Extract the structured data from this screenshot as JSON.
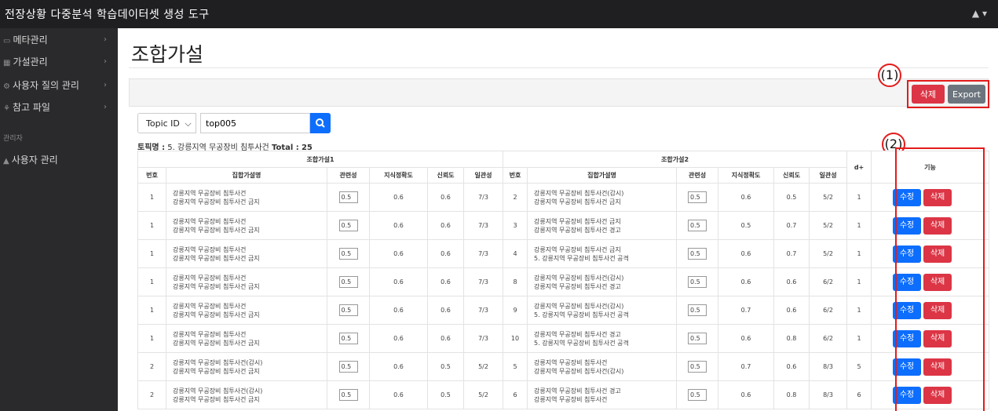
{
  "app": {
    "title": "전장상황 다중분석 학습데이터셋 생성 도구",
    "user_menu": "▲ ▾"
  },
  "sidebar": {
    "items": [
      {
        "icon": "▭",
        "label": "메타관리",
        "chevron": "›"
      },
      {
        "icon": "▦",
        "label": "가설관리",
        "chevron": "›"
      },
      {
        "icon": "⚙",
        "label": "사용자 질의 관리",
        "chevron": "›"
      },
      {
        "icon": "⚘",
        "label": "참고 파일",
        "chevron": "›"
      }
    ],
    "section_heading": "관리자",
    "admin_item": {
      "icon": "▲",
      "label": "사용자 관리"
    }
  },
  "page": {
    "title": "조합가설"
  },
  "toolbar": {
    "delete_label": "삭제",
    "export_label": "Export"
  },
  "annotations": {
    "one": "(1)",
    "two": "(2)"
  },
  "search": {
    "select_value": "Topic ID",
    "select_caret": "⌵",
    "input_value": "top005",
    "button_icon": "⚲"
  },
  "topic": {
    "label": "토픽명 :",
    "name": "5. 강릉지역 무공장비 침투사건",
    "total_label": "Total :",
    "total": "25"
  },
  "table": {
    "group1": "조합가설1",
    "group2": "조합가설2",
    "d_plus": "d+",
    "function_header": "기능",
    "columns": [
      "번호",
      "집합가설명",
      "관련성",
      "지식정확도",
      "신뢰도",
      "일관성"
    ],
    "edit_label": "수정",
    "delete_label": "삭제",
    "rows": [
      {
        "n1": "1",
        "h1a": "강릉지역 무공장비 침투사건",
        "h1b": "강릉지역 무공장비 침투사건 금지",
        "r1": "0.5",
        "k1": "0.6",
        "t1": "0.6",
        "c1": "7/3",
        "n2": "2",
        "h2a": "강릉지역 무공장비 침투사건(감시)",
        "h2b": "강릉지역 무공장비 침투사건 금지",
        "r2": "0.5",
        "k2": "0.6",
        "t2": "0.5",
        "c2": "5/2",
        "d": "1"
      },
      {
        "n1": "1",
        "h1a": "강릉지역 무공장비 침투사건",
        "h1b": "강릉지역 무공장비 침투사건 금지",
        "r1": "0.5",
        "k1": "0.6",
        "t1": "0.6",
        "c1": "7/3",
        "n2": "3",
        "h2a": "강릉지역 무공장비 침투사건 금지",
        "h2b": "강릉지역 무공장비 침투사건 경고",
        "r2": "0.5",
        "k2": "0.5",
        "t2": "0.7",
        "c2": "5/2",
        "d": "1"
      },
      {
        "n1": "1",
        "h1a": "강릉지역 무공장비 침투사건",
        "h1b": "강릉지역 무공장비 침투사건 금지",
        "r1": "0.5",
        "k1": "0.6",
        "t1": "0.6",
        "c1": "7/3",
        "n2": "4",
        "h2a": "강릉지역 무공장비 침투사건 금지",
        "h2b": "5. 강릉지역 무공장비 침투사건 공격",
        "r2": "0.5",
        "k2": "0.6",
        "t2": "0.7",
        "c2": "5/2",
        "d": "1"
      },
      {
        "n1": "1",
        "h1a": "강릉지역 무공장비 침투사건",
        "h1b": "강릉지역 무공장비 침투사건 금지",
        "r1": "0.5",
        "k1": "0.6",
        "t1": "0.6",
        "c1": "7/3",
        "n2": "8",
        "h2a": "강릉지역 무공장비 침투사건(감시)",
        "h2b": "강릉지역 무공장비 침투사건 경고",
        "r2": "0.5",
        "k2": "0.6",
        "t2": "0.6",
        "c2": "6/2",
        "d": "1"
      },
      {
        "n1": "1",
        "h1a": "강릉지역 무공장비 침투사건",
        "h1b": "강릉지역 무공장비 침투사건 금지",
        "r1": "0.5",
        "k1": "0.6",
        "t1": "0.6",
        "c1": "7/3",
        "n2": "9",
        "h2a": "강릉지역 무공장비 침투사건(감시)",
        "h2b": "5. 강릉지역 무공장비 침투사건 공격",
        "r2": "0.5",
        "k2": "0.7",
        "t2": "0.6",
        "c2": "6/2",
        "d": "1"
      },
      {
        "n1": "1",
        "h1a": "강릉지역 무공장비 침투사건",
        "h1b": "강릉지역 무공장비 침투사건 금지",
        "r1": "0.5",
        "k1": "0.6",
        "t1": "0.6",
        "c1": "7/3",
        "n2": "10",
        "h2a": "강릉지역 무공장비 침투사건 경고",
        "h2b": "5. 강릉지역 무공장비 침투사건 공격",
        "r2": "0.5",
        "k2": "0.6",
        "t2": "0.8",
        "c2": "6/2",
        "d": "1"
      },
      {
        "n1": "2",
        "h1a": "강릉지역 무공장비 침투사건(감시)",
        "h1b": "강릉지역 무공장비 침투사건 금지",
        "r1": "0.5",
        "k1": "0.6",
        "t1": "0.5",
        "c1": "5/2",
        "n2": "5",
        "h2a": "강릉지역 무공장비 침투사건",
        "h2b": "강릉지역 무공장비 침투사건(감시)",
        "r2": "0.5",
        "k2": "0.7",
        "t2": "0.6",
        "c2": "8/3",
        "d": "5"
      },
      {
        "n1": "2",
        "h1a": "강릉지역 무공장비 침투사건(감시)",
        "h1b": "강릉지역 무공장비 침투사건 금지",
        "r1": "0.5",
        "k1": "0.6",
        "t1": "0.5",
        "c1": "5/2",
        "n2": "6",
        "h2a": "강릉지역 무공장비 침투사건 경고",
        "h2b": "강릉지역 무공장비 침투사건",
        "r2": "0.5",
        "k2": "0.6",
        "t2": "0.8",
        "c2": "8/3",
        "d": "6"
      }
    ]
  },
  "colors": {
    "topbar": "#1f1f22",
    "sidebar": "#2a2a2d",
    "danger": "#dc3545",
    "primary": "#0d6efd",
    "secondary": "#6c757d",
    "annotation": "#e41b1b"
  }
}
